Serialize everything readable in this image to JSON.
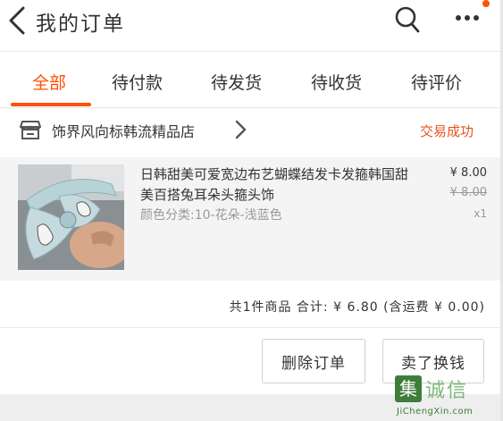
{
  "header": {
    "title": "我的订单",
    "icons": [
      "back-icon",
      "search-icon",
      "more-icon"
    ],
    "accent_color": "#ff5000"
  },
  "tabs": [
    {
      "label": "全部",
      "active": true
    },
    {
      "label": "待付款",
      "active": false
    },
    {
      "label": "待发货",
      "active": false
    },
    {
      "label": "待收货",
      "active": false
    },
    {
      "label": "待评价",
      "active": false
    }
  ],
  "order": {
    "shop_name": "饰界风向标韩流精品店",
    "status": "交易成功",
    "status_color": "#e8531e",
    "product": {
      "title": "日韩甜美可爱宽边布艺蝴蝶结发卡发箍韩国甜美百搭兔耳朵头箍头饰",
      "spec": "颜色分类:10-花朵-浅蓝色",
      "price_current": "¥ 8.00",
      "price_original": "¥ 8.00",
      "quantity": "x1"
    },
    "summary": "共1件商品  合计: ¥ 6.80 (含运费 ¥ 0.00)"
  },
  "actions": {
    "delete_label": "删除订单",
    "sell_label": "卖了换钱"
  },
  "watermark": {
    "badge": "集",
    "text": "诚信",
    "domain": "JiChengXin.com"
  }
}
